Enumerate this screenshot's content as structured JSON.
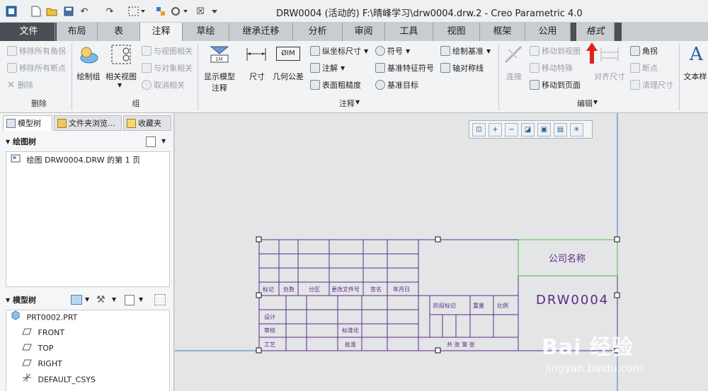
{
  "window": {
    "title": "DRW0004 (活动的) F:\\晴峰学习\\drw0004.drw.2 - Creo Parametric 4.0"
  },
  "quick_access": {
    "undo": "↶",
    "redo": "↷",
    "close": "☒"
  },
  "tabs": {
    "file": "文件",
    "layout": "布局",
    "table": "表",
    "annotate": "注释",
    "sketch": "草绘",
    "legacy": "继承迁移",
    "analysis": "分析",
    "review": "审阅",
    "tools": "工具",
    "view": "视图",
    "frame": "框架",
    "common": "公用",
    "format": "格式"
  },
  "ribbon": {
    "delete_group": {
      "remove_all_corners": "移除所有角拐",
      "remove_all_breaks": "移除所有断点",
      "delete": "删除",
      "label": "删除"
    },
    "group_group": {
      "draw_group": "绘制组",
      "related_view": "相关视图",
      "relate_to_view": "与视图相关",
      "relate_to_object": "与对象相关",
      "unrelate": "取消相关",
      "label": "组"
    },
    "annotate_group": {
      "show_model_annotations_1": "显示模型",
      "show_model_annotations_2": "注释",
      "dimension": "尺寸",
      "geometric_tolerance": "几何公差",
      "ordinate_dimension": "纵坐标尺寸",
      "note": "注解",
      "surface_finish": "表面粗糙度",
      "symbol": "符号",
      "datum_feature_symbol": "基准特征符号",
      "datum_target": "基准目标",
      "draw_datum": "绘制基准",
      "axis_symmetry": "轴对称线",
      "dim_icon_label": "ØIM",
      "label": "注释"
    },
    "edit_group": {
      "connect": "连接",
      "move_to_view": "移动到视图",
      "move_special": "移动特殊",
      "move_to_page": "移动到页面",
      "align_dimensions": "对齐尺寸",
      "corner": "角拐",
      "breakpoint": "断点",
      "cleanup_dimensions": "清理尺寸",
      "label": "编辑"
    },
    "text_style": "文本样"
  },
  "left_panel": {
    "tabs": {
      "model_tree": "模型树",
      "folder_browser": "文件夹浏览...",
      "favorites": "收藏夹"
    },
    "drawing_tree": {
      "header": "绘图树",
      "items": [
        "绘图 DRW0004.DRW 的第 1 页"
      ]
    },
    "model_tree": {
      "header": "模型树",
      "items": [
        "PRT0002.PRT",
        "FRONT",
        "TOP",
        "RIGHT",
        "DEFAULT_CSYS"
      ]
    }
  },
  "title_block": {
    "company": "公司名称",
    "drawing_number": "DRW0004",
    "revision_row": [
      "标记",
      "处数",
      "分区",
      "更改文件号",
      "签名",
      "年月日"
    ],
    "design": "设计",
    "review": "审核",
    "process": "工艺",
    "standardization": "标准化",
    "approval": "批准",
    "stage_mark": "阶段标记",
    "weight": "重量",
    "scale": "比例",
    "sheets": "共  张  第  张"
  },
  "watermark": {
    "brand": "Bai 经验",
    "url": "jingyan.baidu.com"
  },
  "colors": {
    "frame_border": "#6a2a8a",
    "company_box": "#3fc23f",
    "view_line": "#3c78c8",
    "active_tab": "#f2f3f5",
    "dark_tabbar": "#4a4f55",
    "arrow": "#e02020"
  }
}
